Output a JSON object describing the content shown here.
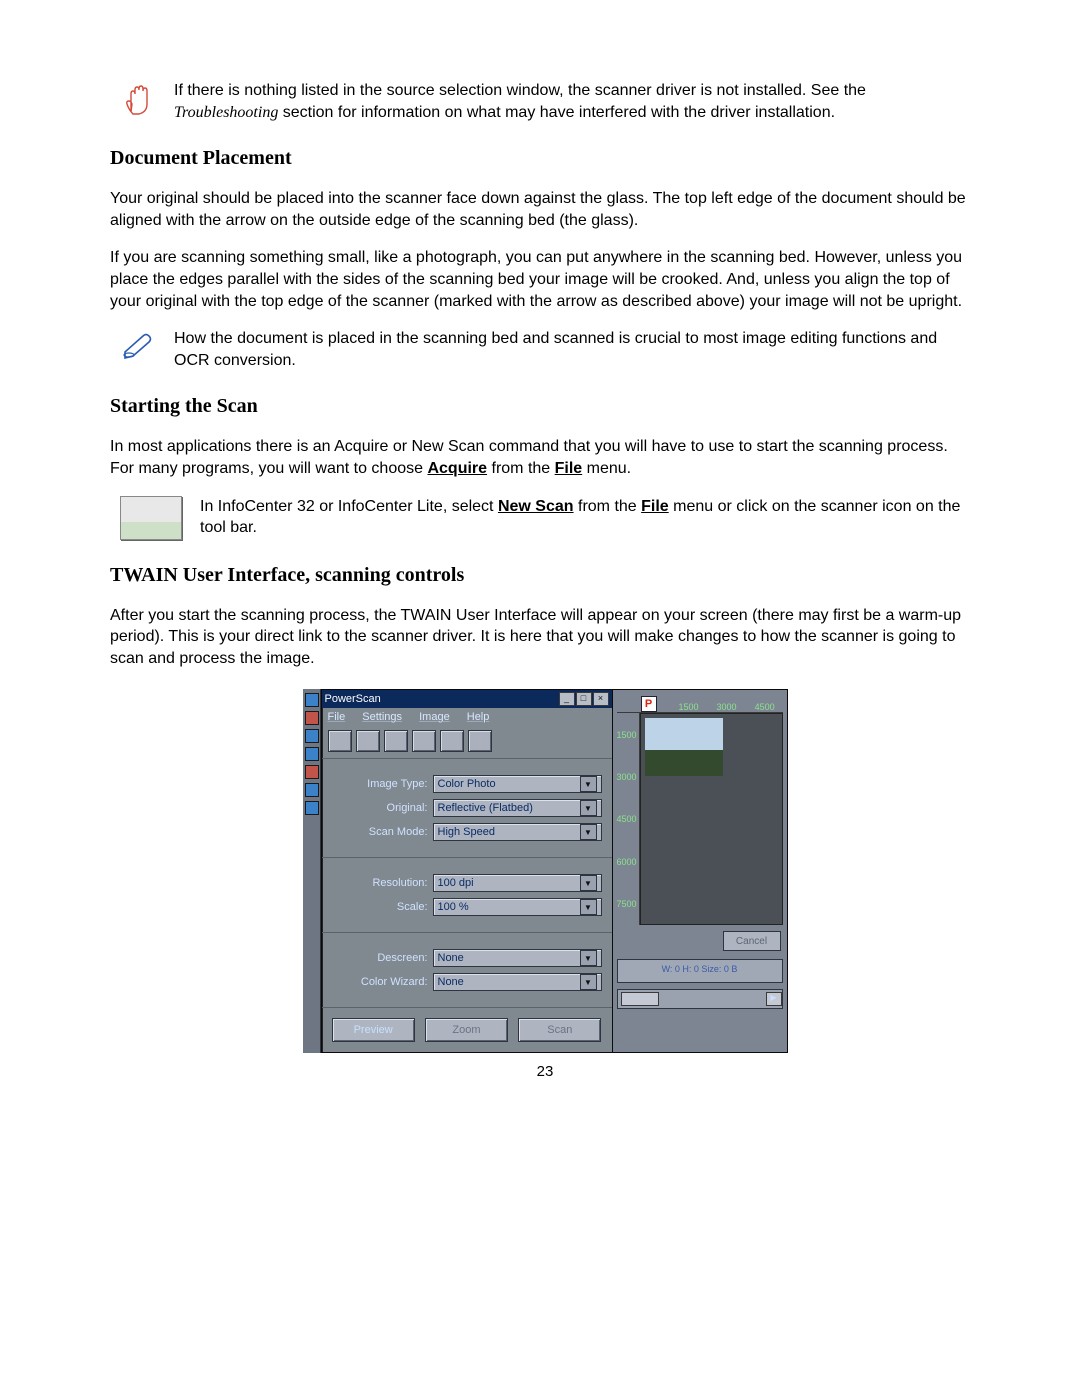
{
  "note1": {
    "text_a": "If there is nothing listed in the source selection window, the scanner driver is not installed. See the ",
    "text_italic": "Troubleshooting",
    "text_b": " section for information on what may have interfered with the driver installation."
  },
  "section1_title": "Document Placement",
  "para1": "Your original should be placed into the scanner face down against the glass.  The top left edge of the document should be aligned with the arrow on the outside edge of the scanning bed (the glass).",
  "para2": "If you are scanning something small, like a photograph, you can put anywhere in the scanning bed.  However, unless you place the edges parallel with the sides of the scanning bed your image will be crooked.  And, unless you align the top of your original with the top edge of the scanner (marked with the arrow as described above) your image will not be upright.",
  "note2": "How the document is placed in the scanning bed and scanned is crucial to most image editing functions and OCR conversion.",
  "section2_title": "Starting the Scan",
  "para3_a": "In most applications there is an Acquire or New Scan command that you will have to use to start the scanning process.  For many programs, you will want to choose ",
  "para3_acquire": "Acquire",
  "para3_b": " from the ",
  "para3_file": "File",
  "para3_c": " menu.",
  "note3_a": "In InfoCenter 32 or InfoCenter Lite, select ",
  "note3_newscan": "New Scan",
  "note3_b": " from the ",
  "note3_file": "File",
  "note3_c": " menu or click on the scanner icon on the tool bar.",
  "section3_title": "TWAIN User Interface, scanning controls",
  "para4": "After you start the scanning process, the TWAIN User Interface will appear on your screen (there may first be a warm-up period).  This is your direct link to the scanner driver.  It is here that you will make changes to how the scanner is going to scan and process the image.",
  "page_number": "23",
  "powerscan": {
    "title": "PowerScan",
    "menu": {
      "file": "File",
      "settings": "Settings",
      "image": "Image",
      "help": "Help"
    },
    "labels": {
      "image_type": "Image Type:",
      "original": "Original:",
      "scan_mode": "Scan Mode:",
      "resolution": "Resolution:",
      "scale": "Scale:",
      "descreen": "Descreen:",
      "color_wizard": "Color Wizard:"
    },
    "values": {
      "image_type": "Color Photo",
      "original": "Reflective (Flatbed)",
      "scan_mode": "High Speed",
      "resolution": "100 dpi",
      "scale": "100 %",
      "descreen": "None",
      "color_wizard": "None"
    },
    "buttons": {
      "preview": "Preview",
      "zoom": "Zoom",
      "scan": "Scan",
      "cancel": "Cancel"
    },
    "ruler_h": [
      "1500",
      "3000",
      "4500"
    ],
    "ruler_v": [
      "1500",
      "3000",
      "4500",
      "6000",
      "7500"
    ],
    "dimensions": "W: 0  H: 0  Size: 0 B",
    "p_badge": "P"
  }
}
